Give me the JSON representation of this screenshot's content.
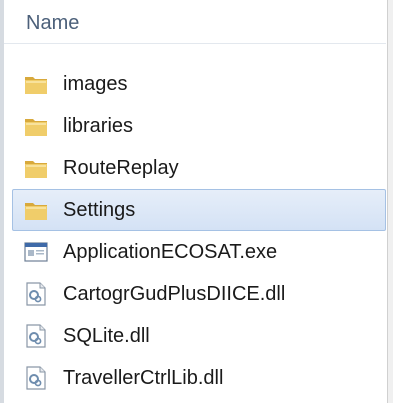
{
  "header": {
    "name_label": "Name"
  },
  "files": [
    {
      "label": "images",
      "type": "folder",
      "icon": "folder-icon",
      "selected": false
    },
    {
      "label": "libraries",
      "type": "folder",
      "icon": "folder-icon",
      "selected": false
    },
    {
      "label": "RouteReplay",
      "type": "folder",
      "icon": "folder-icon",
      "selected": false
    },
    {
      "label": "Settings",
      "type": "folder",
      "icon": "folder-icon",
      "selected": true
    },
    {
      "label": "ApplicationECOSAT.exe",
      "type": "exe",
      "icon": "application-icon",
      "selected": false
    },
    {
      "label": "CartogrGudPlusDIICE.dll",
      "type": "dll",
      "icon": "dll-file-icon",
      "selected": false
    },
    {
      "label": "SQLite.dll",
      "type": "dll",
      "icon": "dll-file-icon",
      "selected": false
    },
    {
      "label": "TravellerCtrlLib.dll",
      "type": "dll",
      "icon": "dll-file-icon",
      "selected": false
    }
  ],
  "colors": {
    "header_text": "#4c607a",
    "selection_fill": "#d4e2f5",
    "selection_border": "#a5c1e4",
    "folder_yellow": "#e9c35a"
  }
}
